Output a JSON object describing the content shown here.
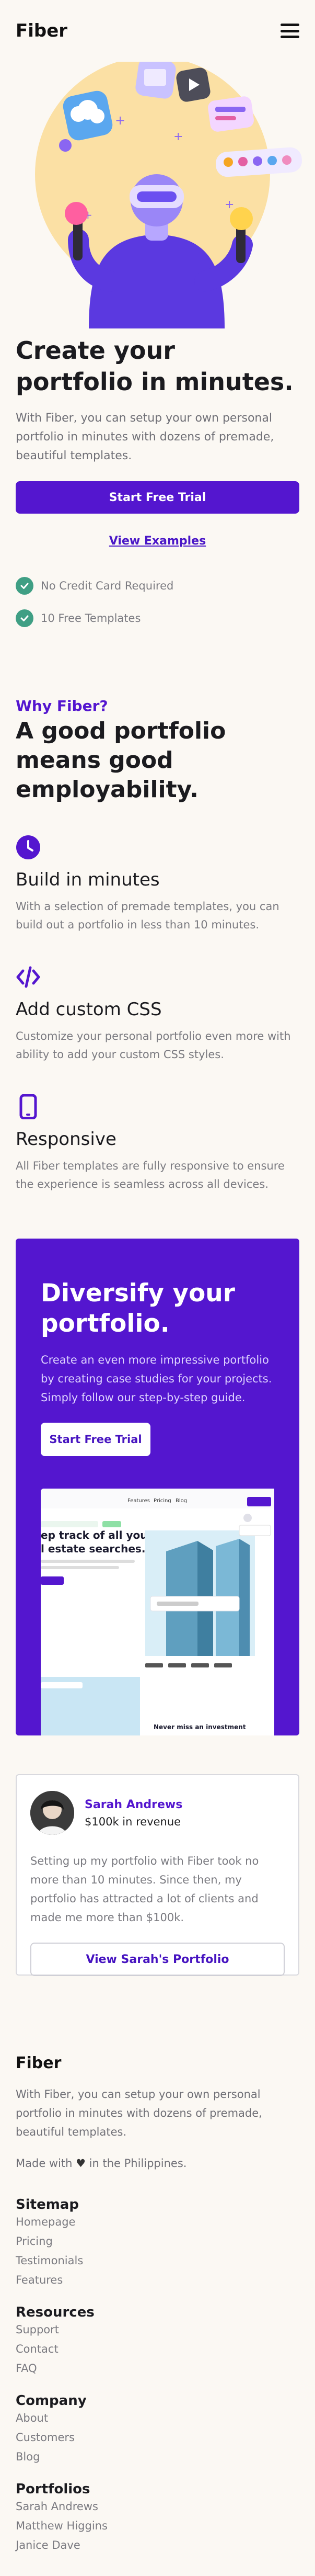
{
  "header": {
    "brand": "Fiber"
  },
  "hero": {
    "title": "Create your portfolio in minutes.",
    "lead": "With Fiber, you can setup your own personal portfolio in minutes with dozens of premade, beautiful templates.",
    "cta_primary": "Start Free Trial",
    "cta_secondary": "View Examples",
    "checks": [
      "No Credit Card Required",
      "10 Free Templates"
    ]
  },
  "why": {
    "kicker": "Why Fiber?",
    "title": "A good portfolio means good employability.",
    "features": [
      {
        "title": "Build in minutes",
        "text": "With a selection of premade templates, you can build out a portfolio in less than 10 minutes.",
        "icon": "clock-icon"
      },
      {
        "title": "Add custom CSS",
        "text": "Customize your personal portfolio even more with ability to add your custom CSS styles.",
        "icon": "code-icon"
      },
      {
        "title": "Responsive",
        "text": "All Fiber templates are fully responsive to ensure the experience is seamless across all devices.",
        "icon": "phone-icon"
      }
    ]
  },
  "promo": {
    "title": "Diversify your portfolio.",
    "text": "Create an even more impressive portfolio by creating case studies for your projects. Simply follow our step-by-step guide.",
    "cta": "Start Free Trial",
    "mock": {
      "nav": [
        "Features",
        "Pricing",
        "Blog"
      ],
      "headline": "ep track of all your\nl estate searches.",
      "tagline": "Never miss an investment"
    }
  },
  "testimonial": {
    "name": "Sarah Andrews",
    "subtitle": "$100k in revenue",
    "quote": "Setting up my portfolio with Fiber took no more than 10 minutes. Since then, my portfolio has attracted a lot of clients and made me more than $100k.",
    "cta": "View Sarah's Portfolio"
  },
  "footer": {
    "brand": "Fiber",
    "text": "With Fiber, you can setup your own personal portfolio in minutes with dozens of premade, beautiful templates.",
    "made_prefix": "Made with",
    "made_suffix": "in the Philippines.",
    "columns": [
      {
        "title": "Sitemap",
        "links": [
          "Homepage",
          "Pricing",
          "Testimonials",
          "Features"
        ]
      },
      {
        "title": "Resources",
        "links": [
          "Support",
          "Contact",
          "FAQ"
        ]
      },
      {
        "title": "Company",
        "links": [
          "About",
          "Customers",
          "Blog"
        ]
      },
      {
        "title": "Portfolios",
        "links": [
          "Sarah Andrews",
          "Matthew Higgins",
          "Janice Dave"
        ]
      }
    ]
  },
  "colors": {
    "brand": "#5416cf",
    "check": "#3f9f84",
    "background": "#fbf8f3"
  }
}
